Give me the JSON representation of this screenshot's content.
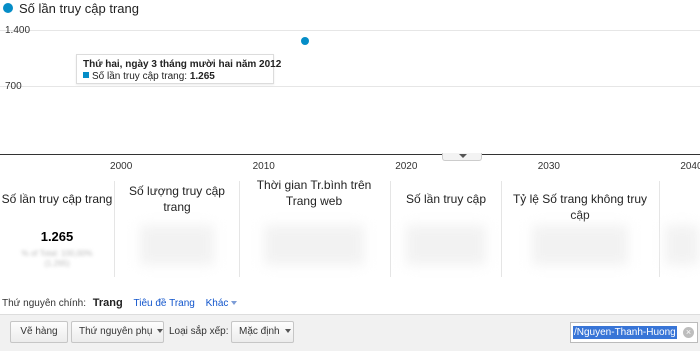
{
  "chart": {
    "legend_label": "Số lần truy cập trang",
    "tooltip": {
      "title": "Thứ hai, ngày 3 tháng mười hai năm 2012",
      "series_label": "Số lần truy cập trang:",
      "series_value": "1.265"
    },
    "accent_color": "#058dc7"
  },
  "chart_data": {
    "type": "scatter",
    "series": [
      {
        "name": "Số lần truy cập trang",
        "x": [
          2012.92
        ],
        "y": [
          1265
        ]
      }
    ],
    "xticks": [
      "2000",
      "2010",
      "2020",
      "2030",
      "2040"
    ],
    "yticks": [
      "1.400",
      "700"
    ],
    "xlim": [
      1991.5,
      2040.6
    ],
    "ylim": [
      0,
      1400
    ],
    "grid": true
  },
  "scorecards": [
    {
      "title": "Số lần truy cập trang",
      "value": "1.265",
      "sub": "% of Total: 100,00% (1.265)",
      "blurred": false
    },
    {
      "title": "Số lượng truy cập trang",
      "value": "",
      "sub": "",
      "blurred": true
    },
    {
      "title": "Thời gian Tr.bình trên Trang web",
      "value": "",
      "sub": "",
      "blurred": true
    },
    {
      "title": "Số lần truy cập",
      "value": "",
      "sub": "",
      "blurred": true
    },
    {
      "title": "Tỷ lệ Số trang không truy cập",
      "value": "",
      "sub": "",
      "blurred": true
    }
  ],
  "dimension": {
    "label": "Thứ nguyên chính:",
    "active": "Trang",
    "option_1": "Tiêu đề Trang",
    "option_more": "Khác"
  },
  "toolbar": {
    "plot_rows": "Vẽ hàng",
    "secondary_dimension": "Thứ nguyên phụ",
    "sort_type_label": "Loại sắp xếp:",
    "sort_type_value": "Mặc định",
    "search_value": "/Nguyen-Thanh-Huong"
  }
}
